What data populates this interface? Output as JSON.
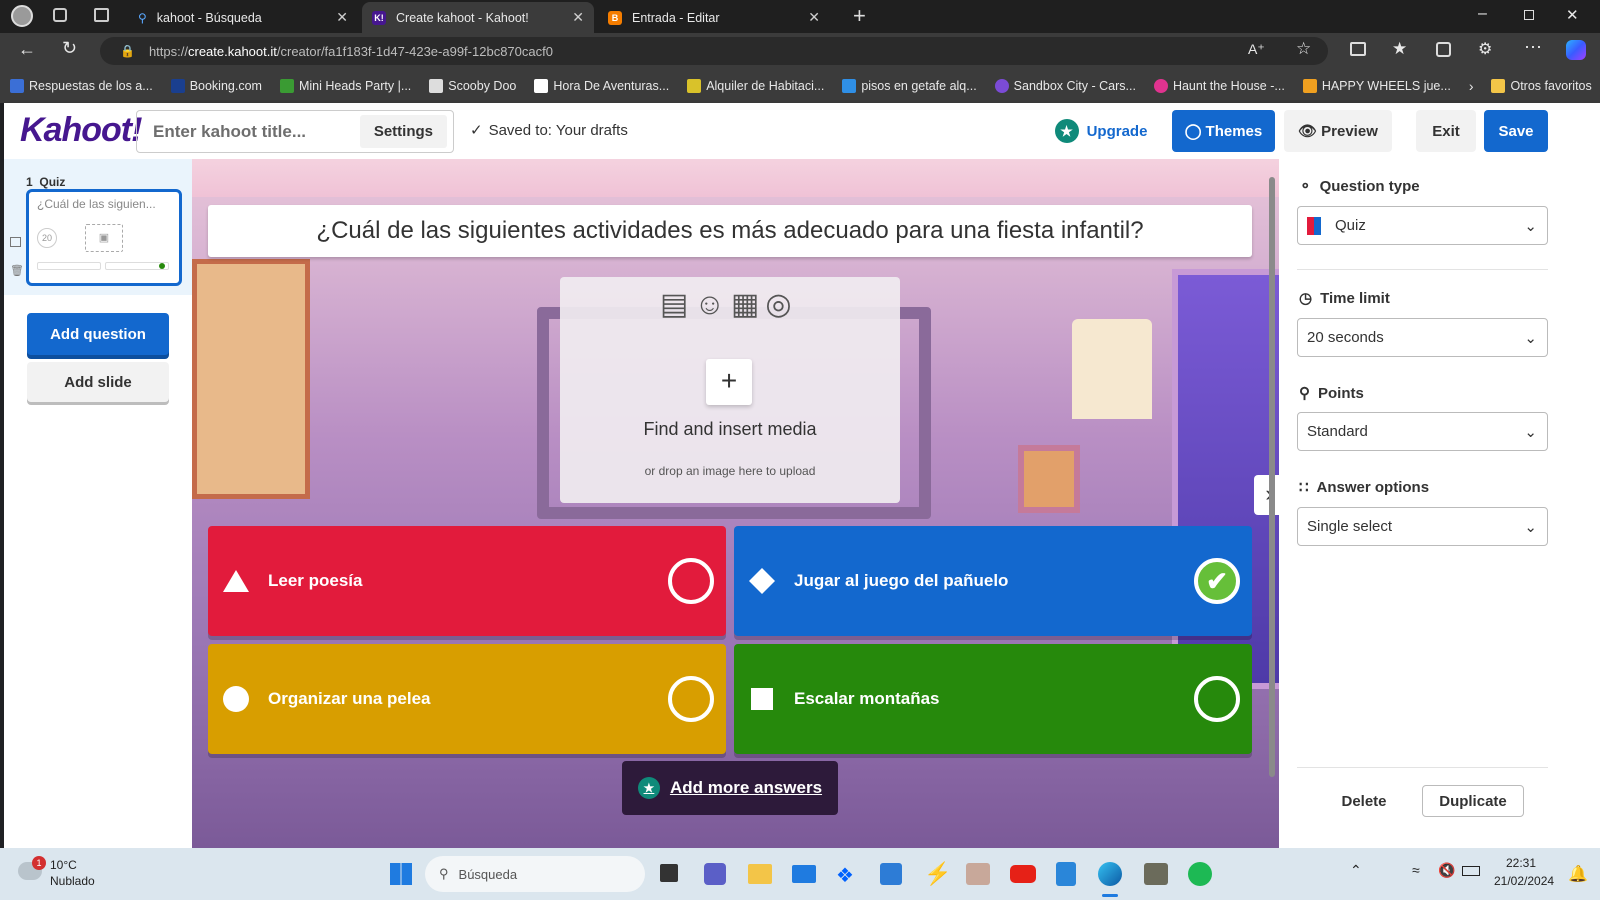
{
  "browser": {
    "tabs": [
      {
        "label": "kahoot - Búsqueda"
      },
      {
        "label": "Create kahoot - Kahoot!"
      },
      {
        "label": "Entrada - Editar"
      }
    ],
    "url_prefix": "https://",
    "url_host": "create.kahoot.it",
    "url_path": "/creator/fa1f183f-1d47-423e-a99f-12bc870cacf0",
    "bookmarks": [
      {
        "label": "Respuestas de los a...",
        "color": "#3b6fd6"
      },
      {
        "label": "Booking.com",
        "color": "#1a3f8f"
      },
      {
        "label": "Mini Heads Party |...",
        "color": "#3a9b33"
      },
      {
        "label": "Scooby Doo",
        "color": "#dddddd"
      },
      {
        "label": "Hora De Aventuras...",
        "color": "#ffffff"
      },
      {
        "label": "Alquiler de Habitaci...",
        "color": "#d9c22a"
      },
      {
        "label": "pisos en getafe alq...",
        "color": "#2f8fe6"
      },
      {
        "label": "Sandbox City - Cars...",
        "color": "#7b4bd6"
      },
      {
        "label": "Haunt the House -...",
        "color": "#e0338f"
      },
      {
        "label": "HAPPY WHEELS jue...",
        "color": "#f0a020"
      }
    ],
    "other_favorites": "Otros favoritos"
  },
  "app": {
    "logo": "Kahoot!",
    "title_placeholder": "Enter kahoot title...",
    "settings_label": "Settings",
    "saved_text": "Saved to: Your drafts",
    "upgrade_label": "Upgrade",
    "themes_label": "Themes",
    "preview_label": "Preview",
    "exit_label": "Exit",
    "save_label": "Save"
  },
  "sidebar": {
    "slide_number": "1",
    "slide_type": "Quiz",
    "slide_preview_text": "¿Cuál de las siguien...",
    "slide_timer": "20",
    "add_question_label": "Add question",
    "add_slide_label": "Add slide"
  },
  "editor": {
    "question": "¿Cuál de las siguientes actividades es más adecuado para una fiesta infantil?",
    "media_title": "Find and insert media",
    "media_subtitle": "or drop an image here to upload",
    "answers": [
      {
        "label": "Leer poesía",
        "color": "#e21b3c",
        "correct": false
      },
      {
        "label": "Jugar al juego del pañuelo",
        "color": "#1368ce",
        "correct": true
      },
      {
        "label": "Organizar una pelea",
        "color": "#d89e00",
        "correct": false
      },
      {
        "label": "Escalar montañas",
        "color": "#26890c",
        "correct": false
      }
    ],
    "add_more_label": "Add more answers"
  },
  "panel": {
    "question_type_label": "Question type",
    "question_type_value": "Quiz",
    "time_limit_label": "Time limit",
    "time_limit_value": "20 seconds",
    "points_label": "Points",
    "points_value": "Standard",
    "answer_options_label": "Answer options",
    "answer_options_value": "Single select",
    "delete_label": "Delete",
    "duplicate_label": "Duplicate"
  },
  "taskbar": {
    "weather_temp": "10°C",
    "weather_desc": "Nublado",
    "weather_badge": "1",
    "search_placeholder": "Búsqueda",
    "time": "22:31",
    "date": "21/02/2024"
  }
}
